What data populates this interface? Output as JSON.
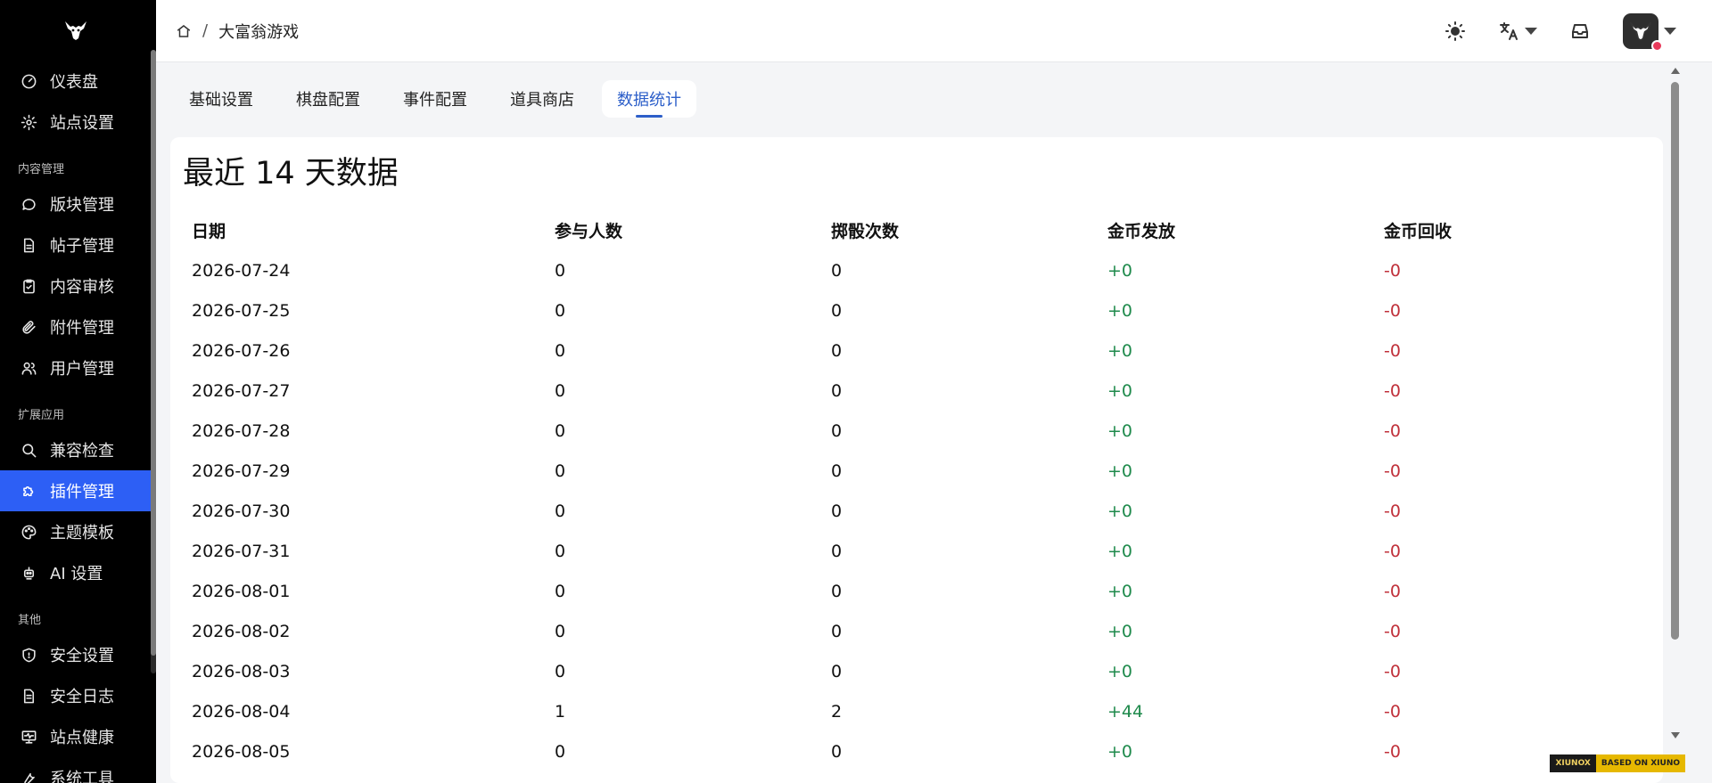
{
  "sidebar": {
    "logo_icon": "bull-head-icon",
    "sections": [
      {
        "title": "",
        "items": [
          {
            "label": "仪表盘",
            "icon": "dashboard-icon"
          },
          {
            "label": "站点设置",
            "icon": "gear-icon"
          }
        ]
      },
      {
        "title": "内容管理",
        "items": [
          {
            "label": "版块管理",
            "icon": "chat-bubble-icon"
          },
          {
            "label": "帖子管理",
            "icon": "document-icon"
          },
          {
            "label": "内容审核",
            "icon": "clipboard-check-icon"
          },
          {
            "label": "附件管理",
            "icon": "paperclip-icon"
          },
          {
            "label": "用户管理",
            "icon": "users-icon"
          }
        ]
      },
      {
        "title": "扩展应用",
        "items": [
          {
            "label": "兼容检查",
            "icon": "search-icon"
          },
          {
            "label": "插件管理",
            "icon": "puzzle-icon",
            "active": true
          },
          {
            "label": "主题模板",
            "icon": "palette-icon"
          },
          {
            "label": "AI 设置",
            "icon": "robot-icon"
          }
        ]
      },
      {
        "title": "其他",
        "items": [
          {
            "label": "安全设置",
            "icon": "shield-icon"
          },
          {
            "label": "安全日志",
            "icon": "log-icon"
          },
          {
            "label": "站点健康",
            "icon": "monitor-heart-icon"
          },
          {
            "label": "系统工具",
            "icon": "tool-icon"
          }
        ]
      }
    ]
  },
  "header": {
    "breadcrumb": {
      "home_icon": "home-icon",
      "separator": "/",
      "current": "大富翁游戏"
    },
    "actions": [
      "sun-icon",
      "translate-icon",
      "inbox-icon",
      "avatar"
    ]
  },
  "tabs": [
    {
      "label": "基础设置"
    },
    {
      "label": "棋盘配置"
    },
    {
      "label": "事件配置"
    },
    {
      "label": "道具商店"
    },
    {
      "label": "数据统计",
      "active": true
    }
  ],
  "stats": {
    "title": "最近 14 天数据",
    "columns": [
      "日期",
      "参与人数",
      "掷骰次数",
      "金币发放",
      "金币回收"
    ],
    "rows": [
      [
        "2026-07-24",
        "0",
        "0",
        "+0",
        "-0"
      ],
      [
        "2026-07-25",
        "0",
        "0",
        "+0",
        "-0"
      ],
      [
        "2026-07-26",
        "0",
        "0",
        "+0",
        "-0"
      ],
      [
        "2026-07-27",
        "0",
        "0",
        "+0",
        "-0"
      ],
      [
        "2026-07-28",
        "0",
        "0",
        "+0",
        "-0"
      ],
      [
        "2026-07-29",
        "0",
        "0",
        "+0",
        "-0"
      ],
      [
        "2026-07-30",
        "0",
        "0",
        "+0",
        "-0"
      ],
      [
        "2026-07-31",
        "0",
        "0",
        "+0",
        "-0"
      ],
      [
        "2026-08-01",
        "0",
        "0",
        "+0",
        "-0"
      ],
      [
        "2026-08-02",
        "0",
        "0",
        "+0",
        "-0"
      ],
      [
        "2026-08-03",
        "0",
        "0",
        "+0",
        "-0"
      ],
      [
        "2026-08-04",
        "1",
        "2",
        "+44",
        "-0"
      ],
      [
        "2026-08-05",
        "0",
        "0",
        "+0",
        "-0"
      ]
    ]
  },
  "footer_badge": {
    "left": "XIUNOX",
    "right": "BASED ON XIUNO"
  },
  "colors": {
    "active_nav": "#2d5ff5",
    "active_tab": "#2d5fc9",
    "positive": "#1f8a4c",
    "negative": "#c0303a"
  }
}
